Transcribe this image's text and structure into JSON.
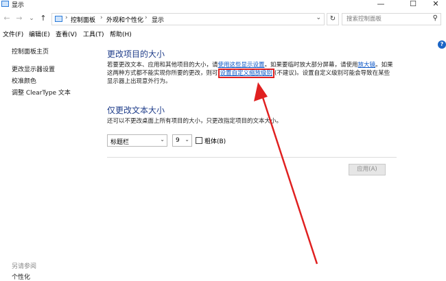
{
  "window": {
    "title": "显示",
    "minimize": "—",
    "maximize": "☐",
    "close": "✕"
  },
  "nav": {
    "back": "←",
    "forward": "→",
    "dropdown": "⌄",
    "up": "↑",
    "breadcrumbs": [
      "控制面板",
      "外观和个性化",
      "显示"
    ],
    "separator": "›",
    "address_dropdown": "⌄",
    "refresh": "↻",
    "search_placeholder": "搜索控制面板",
    "search_glyph": "⚲"
  },
  "menu": [
    "文件(F)",
    "编辑(E)",
    "查看(V)",
    "工具(T)",
    "帮助(H)"
  ],
  "sidebar": {
    "home": "控制面板主页",
    "items": [
      "更改显示器设置",
      "校准颜色",
      "调整 ClearType 文本"
    ],
    "see_also": "另请参阅",
    "see_also_items": [
      "个性化"
    ]
  },
  "help": "?",
  "section1": {
    "title": "更改项目的大小",
    "text_a": "若要更改文本、应用和其他项目的大小，请",
    "link_a": "使用这些显示设置",
    "text_b": "。如果要临时放大部分屏幕，请使用",
    "link_b": "放大镜",
    "text_c": "。如果这两种方式都不能实现你所要的更改，则可",
    "link_c": "设置自定义缩放级别",
    "text_d": "(不建议)。设置自定义级别可能会导致在某些显示器上出现意外行为。"
  },
  "section2": {
    "title": "仅更改文本大小",
    "desc": "还可以不更改桌面上所有项目的大小，只更改指定项目的文本大小。",
    "item_select": "标题栏",
    "size_select": "9",
    "select_arrow": "⌄",
    "bold_label": "粗体(B)",
    "apply_label": "应用(A)"
  },
  "colors": {
    "annotation": "#e02020",
    "link": "#0a55c5",
    "heading": "#1f3d8a"
  }
}
